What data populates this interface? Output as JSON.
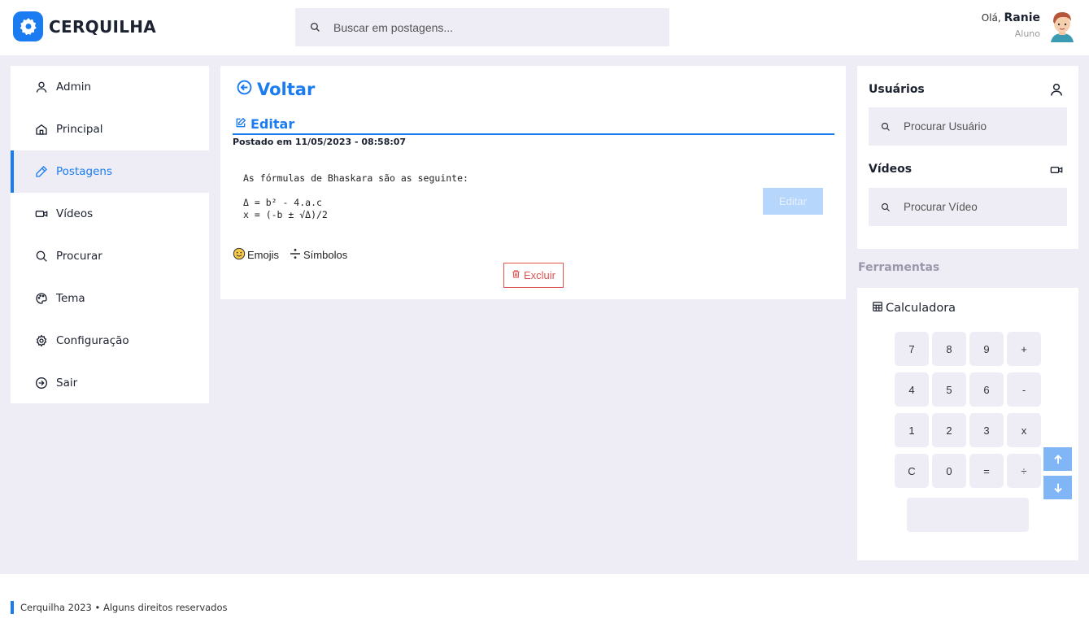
{
  "header": {
    "app_name": "CERQUILHA",
    "search_placeholder": "Buscar em postagens...",
    "greeting": "Olá,",
    "user_name": "Ranie",
    "user_role": "Aluno"
  },
  "sidebar": {
    "items": [
      {
        "label": "Admin",
        "icon": "user-icon",
        "active": false
      },
      {
        "label": "Principal",
        "icon": "home-icon",
        "active": false
      },
      {
        "label": "Postagens",
        "icon": "pencil-icon",
        "active": true
      },
      {
        "label": "Vídeos",
        "icon": "video-icon",
        "active": false
      },
      {
        "label": "Procurar",
        "icon": "search-icon",
        "active": false
      },
      {
        "label": "Tema",
        "icon": "palette-icon",
        "active": false
      },
      {
        "label": "Configuração",
        "icon": "gear-icon",
        "active": false
      },
      {
        "label": "Sair",
        "icon": "logout-icon",
        "active": false
      }
    ]
  },
  "post": {
    "back_label": "Voltar",
    "edit_tab_label": "Editar",
    "posted_at": "Postado em 11/05/2023 - 08:58:07",
    "content_lines": [
      "As fórmulas de Bhaskara são as seguinte:",
      "",
      "Δ = b² - 4.a.c",
      "x = (-b ± √Δ)/2"
    ],
    "edit_button": "Editar",
    "emojis_label": "Emojis",
    "symbols_label": "Símbolos",
    "delete_button": "Excluir"
  },
  "right": {
    "users_title": "Usuários",
    "users_search_placeholder": "Procurar Usuário",
    "videos_title": "Vídeos",
    "videos_search_placeholder": "Procurar Vídeo",
    "tools_title": "Ferramentas",
    "calculator_title": "Calculadora",
    "calculator_keys": [
      "7",
      "8",
      "9",
      "+",
      "4",
      "5",
      "6",
      "-",
      "1",
      "2",
      "3",
      "x",
      "C",
      "0",
      "=",
      "÷"
    ]
  },
  "footer": {
    "text": "Cerquilha 2023 • Alguns direitos reservados"
  },
  "colors": {
    "accent": "#1a7cf0",
    "background": "#eeedf6",
    "danger": "#e05252"
  }
}
